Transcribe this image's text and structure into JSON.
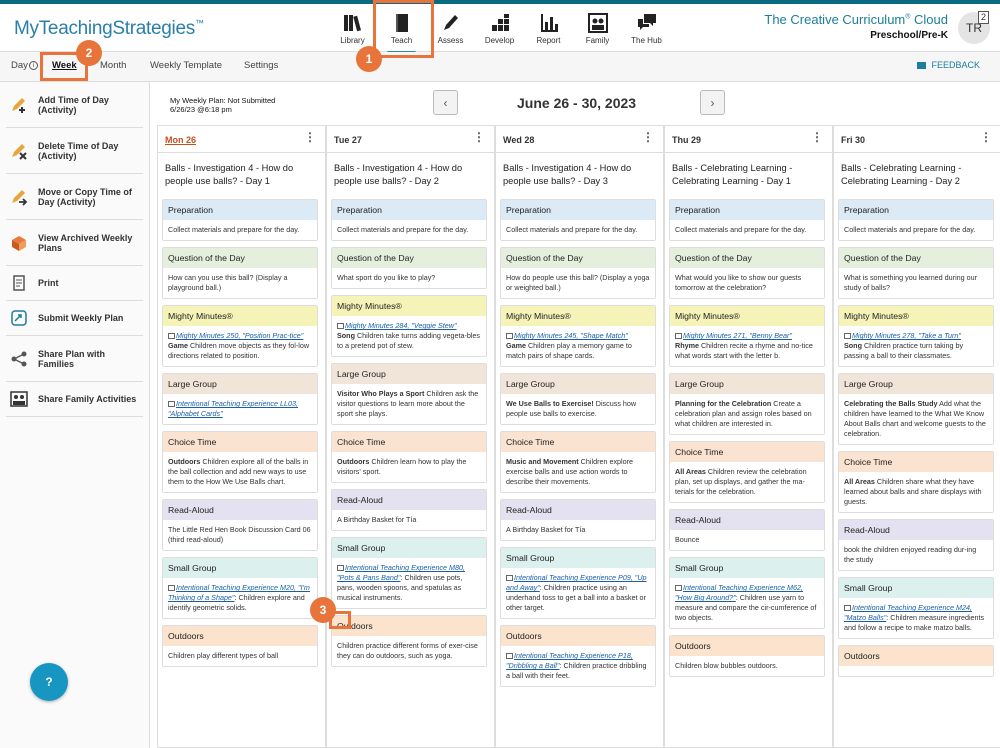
{
  "header": {
    "logo": "MyTeachingStrategies",
    "logo_tm": "™",
    "brand_title": "The Creative Curriculum",
    "brand_reg": "®",
    "brand_cloud": " Cloud",
    "brand_level": "Preschool/Pre-K",
    "avatar": "TR",
    "notif_count": "2",
    "nav": [
      {
        "label": "Library",
        "icon": "library-icon"
      },
      {
        "label": "Teach",
        "icon": "book-icon",
        "active": true
      },
      {
        "label": "Assess",
        "icon": "pencil-icon"
      },
      {
        "label": "Develop",
        "icon": "blocks-icon"
      },
      {
        "label": "Report",
        "icon": "bar-chart-icon"
      },
      {
        "label": "Family",
        "icon": "family-icon"
      },
      {
        "label": "The Hub",
        "icon": "chat-icon"
      }
    ]
  },
  "subnav": {
    "tabs": [
      "Day",
      "Week",
      "Month",
      "Weekly Template",
      "Settings"
    ],
    "active_tab": "Week",
    "feedback": "FEEDBACK"
  },
  "sidebar": {
    "items": [
      {
        "label": "Add Time of Day (Activity)",
        "icon": "add-time-icon"
      },
      {
        "label": "Delete Time of Day (Activity)",
        "icon": "delete-time-icon"
      },
      {
        "label": "Move or Copy Time of Day (Activity)",
        "icon": "move-copy-icon"
      },
      {
        "label": "View Archived Weekly Plans",
        "icon": "archive-icon"
      },
      {
        "label": "Print",
        "icon": "print-icon"
      },
      {
        "label": "Submit Weekly Plan",
        "icon": "submit-icon"
      },
      {
        "label": "Share Plan with Families",
        "icon": "share-icon"
      },
      {
        "label": "Share Family Activities",
        "icon": "family-activities-icon"
      }
    ],
    "help": "?"
  },
  "plan": {
    "status": "My Weekly Plan: Not Submitted",
    "date": "6/26/23 @6:18 pm",
    "range": "June 26 - 30, 2023",
    "prev": "‹",
    "next": "›"
  },
  "days": [
    {
      "name": "Mon 26",
      "today": true,
      "title": "Balls - Investigation 4 - How do people use balls? - Day 1",
      "acts": [
        {
          "h": "Preparation",
          "c": "c-prep",
          "b": "Collect materials and prepare for the day."
        },
        {
          "h": "Question of the Day",
          "c": "c-qotd",
          "b": "How can you use this ball? (Display a playground ball.)"
        },
        {
          "h": "Mighty Minutes®",
          "c": "c-mm",
          "link": "Mighty Minutes 250, \"Position Prac-tice\"",
          "bold": "Game",
          "b": " Children move objects as they fol-low directions related to position."
        },
        {
          "h": "Large Group",
          "c": "c-lg",
          "link": "Intentional Teaching Experience LL03, \"Alphabet Cards\""
        },
        {
          "h": "Choice Time",
          "c": "c-ct",
          "bold": "Outdoors",
          "b": " Children explore all of the balls in the ball collection and add new ways to use them to the How We Use Balls chart."
        },
        {
          "h": "Read-Aloud",
          "c": "c-ra",
          "b": "The Little Red Hen Book Discussion Card 06 (third read-aloud)"
        },
        {
          "h": "Small Group",
          "c": "c-sg",
          "link": "Intentional Teaching Experience M20, \"I'm Thinking of a Shape\"",
          "b": ": Children explore and identify geometric solids."
        },
        {
          "h": "Outdoors",
          "c": "c-out",
          "b": "Children play different types of ball"
        }
      ]
    },
    {
      "name": "Tue 27",
      "title": "Balls - Investigation 4 - How do people use balls? - Day 2",
      "acts": [
        {
          "h": "Preparation",
          "c": "c-prep",
          "b": "Collect materials and prepare for the day."
        },
        {
          "h": "Question of the Day",
          "c": "c-qotd",
          "b": "What sport do you like to play?"
        },
        {
          "h": "Mighty Minutes®",
          "c": "c-mm",
          "link": "Mighty Minutes 284, \"Veggie Stew\"",
          "bold": "Song",
          "b": " Children take turns adding vegeta-bles to a pretend pot of stew."
        },
        {
          "h": "Large Group",
          "c": "c-lg",
          "bold": "Visitor Who Plays a Sport",
          "b": " Children ask the visitor questions to learn more about the sport she plays."
        },
        {
          "h": "Choice Time",
          "c": "c-ct",
          "bold": "Outdoors",
          "b": " Children learn how to play the visitors' sport."
        },
        {
          "h": "Read-Aloud",
          "c": "c-ra",
          "b": "A Birthday Basket for Tía"
        },
        {
          "h": "Small Group",
          "c": "c-sg",
          "link": "Intentional Teaching Experience M80, \"Pots & Pans Band\"",
          "b": ": Children use pots, pans, wooden spoons, and spatulas as musical instruments."
        },
        {
          "h": "Outdoors",
          "c": "c-out",
          "b": "Children practice different forms of exer-cise they can do outdoors, such as yoga."
        }
      ]
    },
    {
      "name": "Wed 28",
      "title": "Balls - Investigation 4 - How do people use balls? - Day 3",
      "acts": [
        {
          "h": "Preparation",
          "c": "c-prep",
          "b": "Collect materials and prepare for the day."
        },
        {
          "h": "Question of the Day",
          "c": "c-qotd",
          "b": "How do people use this ball? (Display a yoga or weighted ball.)"
        },
        {
          "h": "Mighty Minutes®",
          "c": "c-mm",
          "link": "Mighty Minutes 245, \"Shape Match\"",
          "bold": "Game",
          "b": " Children play a memory game to match pairs of shape cards."
        },
        {
          "h": "Large Group",
          "c": "c-lg",
          "bold": "We Use Balls to Exercise!",
          "b": " Discuss how people use balls to exercise."
        },
        {
          "h": "Choice Time",
          "c": "c-ct",
          "bold": "Music and Movement",
          "b": " Children explore exercise balls and use action words to describe their movements."
        },
        {
          "h": "Read-Aloud",
          "c": "c-ra",
          "b": "A Birthday Basket for Tía"
        },
        {
          "h": "Small Group",
          "c": "c-sg",
          "link": "Intentional Teaching Experience P09, \"Up and Away\"",
          "b": ": Children practice using an underhand toss to get a ball into a basket or other target."
        },
        {
          "h": "Outdoors",
          "c": "c-out",
          "link": "Intentional Teaching Experience P18, \"Dribbling a Ball\"",
          "b": ": Children practice dribbling a ball with their feet."
        }
      ]
    },
    {
      "name": "Thu 29",
      "title": "Balls - Celebrating Learning - Celebrating Learning - Day 1",
      "acts": [
        {
          "h": "Preparation",
          "c": "c-prep",
          "b": "Collect materials and prepare for the day."
        },
        {
          "h": "Question of the Day",
          "c": "c-qotd",
          "b": "What would you like to show our guests tomorrow at the celebration?"
        },
        {
          "h": "Mighty Minutes®",
          "c": "c-mm",
          "link": "Mighty Minutes 271, \"Benny Bear\"",
          "bold": "Rhyme",
          "b": " Children recite a rhyme and no-tice what words start with the letter b."
        },
        {
          "h": "Large Group",
          "c": "c-lg",
          "bold": "Planning for the Celebration",
          "b": " Create a celebration plan and assign roles based on what children are interested in."
        },
        {
          "h": "Choice Time",
          "c": "c-ct",
          "bold": "All Areas",
          "b": " Children review the celebration plan, set up displays, and gather the ma-terials for the celebration."
        },
        {
          "h": "Read-Aloud",
          "c": "c-ra",
          "b": "Bounce"
        },
        {
          "h": "Small Group",
          "c": "c-sg",
          "link": "Intentional Teaching Experience M62, \"How Big Around?\"",
          "b": ": Children use yarn to measure and compare the cir-cumference of two objects."
        },
        {
          "h": "Outdoors",
          "c": "c-out",
          "b": "Children blow bubbles outdoors."
        }
      ]
    },
    {
      "name": "Fri 30",
      "title": "Balls - Celebrating Learning - Celebrating Learning - Day 2",
      "acts": [
        {
          "h": "Preparation",
          "c": "c-prep",
          "b": "Collect materials and prepare for the day."
        },
        {
          "h": "Question of the Day",
          "c": "c-qotd",
          "b": "What is something you learned during our study of balls?"
        },
        {
          "h": "Mighty Minutes®",
          "c": "c-mm",
          "link": "Mighty Minutes 278, \"Take a Turn\"",
          "bold": "Song",
          "b": " Children practice turn taking by passing a ball to their classmates."
        },
        {
          "h": "Large Group",
          "c": "c-lg",
          "bold": "Celebrating the Balls Study",
          "b": " Add what the children have learned to the What We Know About Balls chart and welcome guests to the celebration."
        },
        {
          "h": "Choice Time",
          "c": "c-ct",
          "bold": "All Areas",
          "b": " Children share what they have learned about balls and share displays with guests."
        },
        {
          "h": "Read-Aloud",
          "c": "c-ra",
          "b": "book the children enjoyed reading dur-ing the study"
        },
        {
          "h": "Small Group",
          "c": "c-sg",
          "link": "Intentional Teaching Experience M24, \"Matzo Balls\"",
          "b": ": Children measure ingredients and follow a recipe to make matzo balls."
        },
        {
          "h": "Outdoors",
          "c": "c-out",
          "b": ""
        }
      ]
    }
  ],
  "callouts": [
    "1",
    "2",
    "3"
  ],
  "colors": {
    "accent": "#e8743b",
    "brand": "#1c7d9c",
    "today": "#c0501c"
  }
}
